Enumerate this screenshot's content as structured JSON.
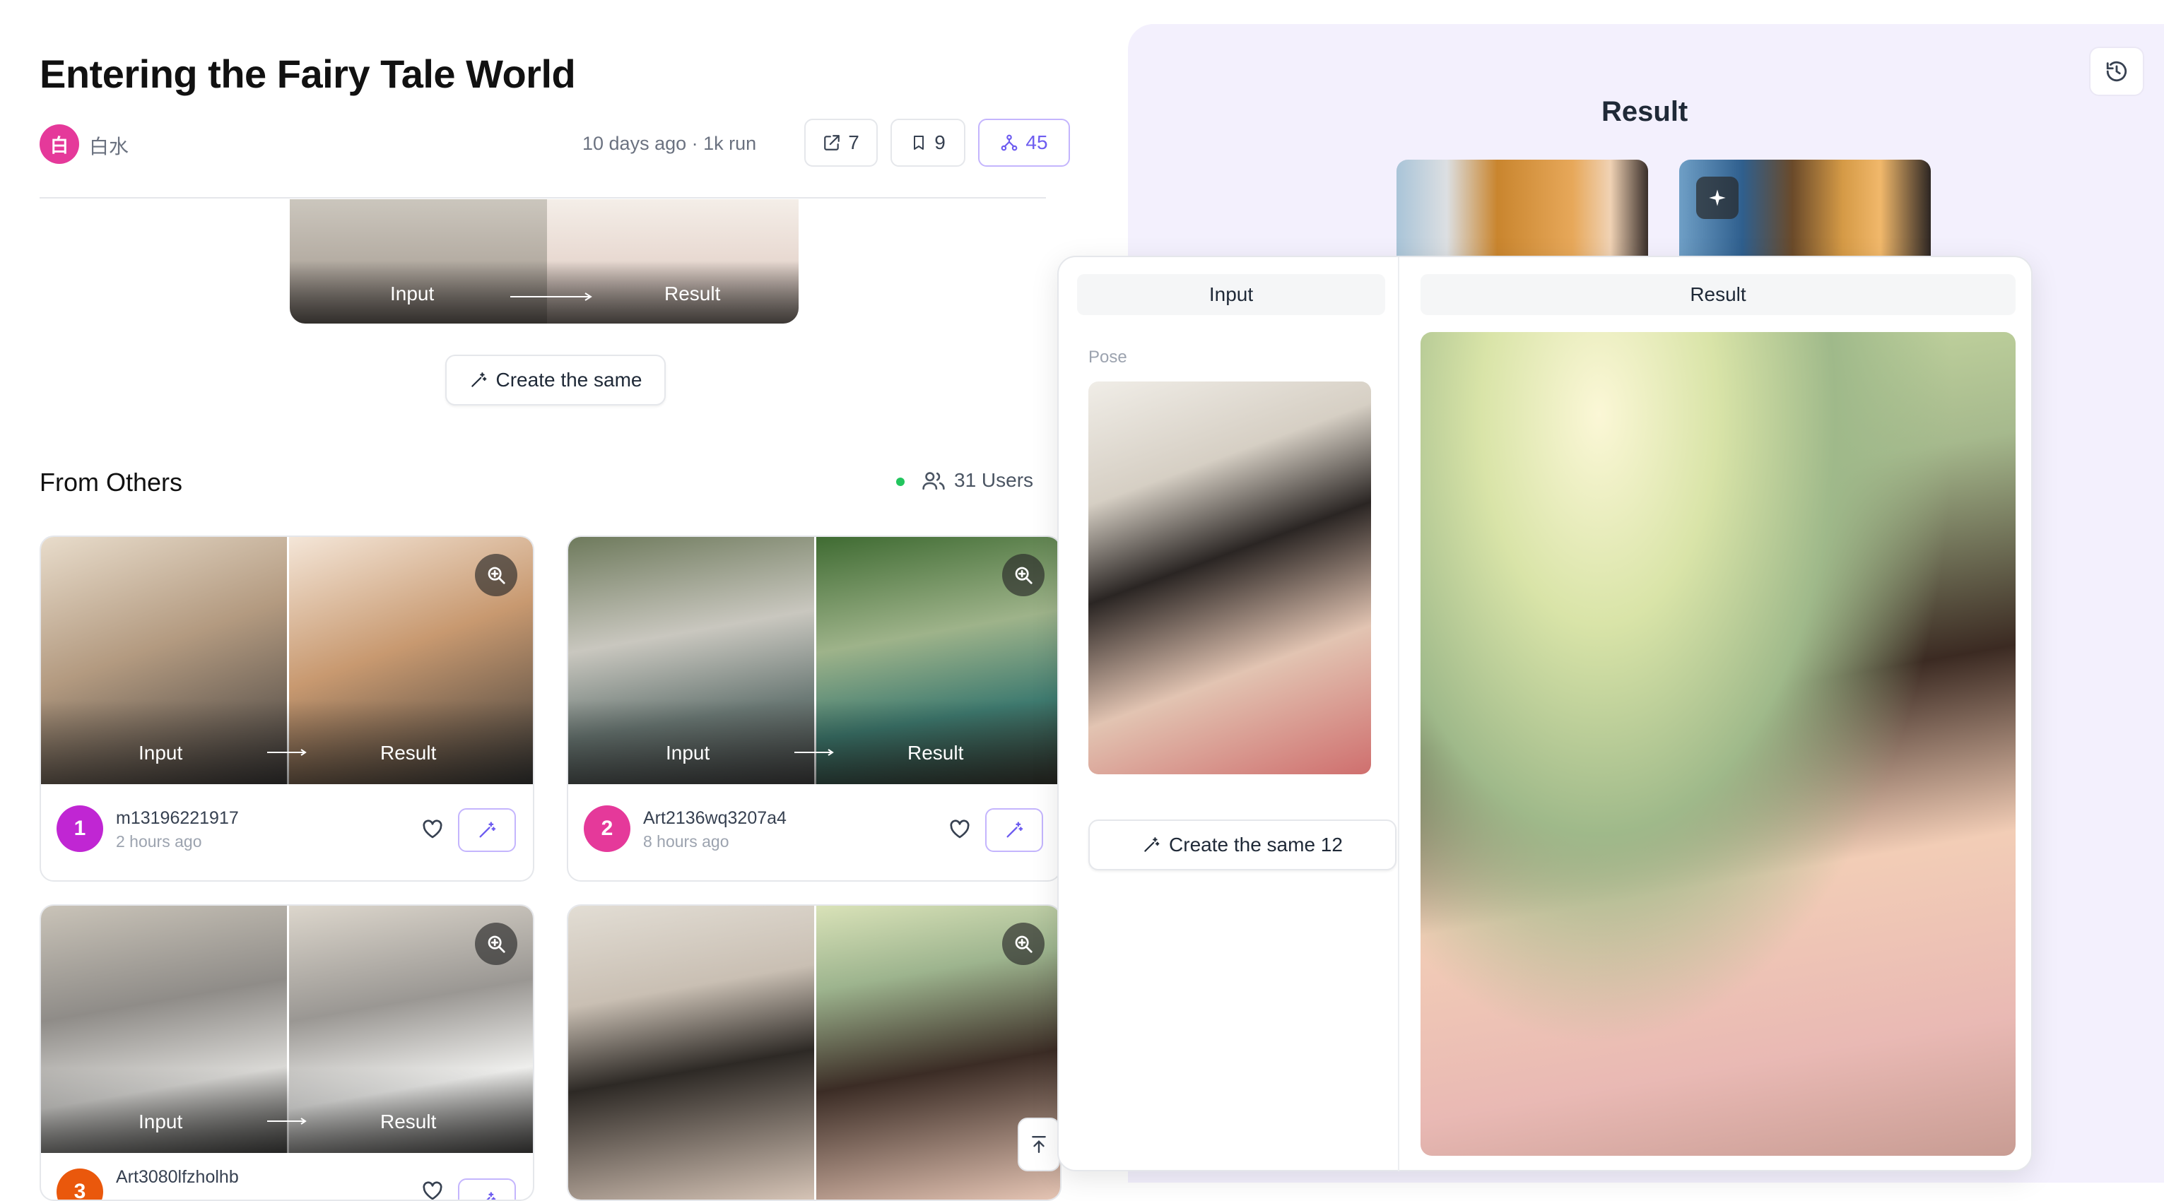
{
  "header": {
    "title": "Entering the Fairy Tale World",
    "author_initial": "白",
    "author_name": "白水",
    "meta": "10 days ago · 1k run",
    "stats": {
      "shares": "7",
      "bookmarks": "9",
      "forks": "45"
    }
  },
  "hero": {
    "input_label": "Input",
    "result_label": "Result"
  },
  "create_same_label": "Create the same",
  "others": {
    "heading": "From Others",
    "users_label": "31 Users",
    "cards": [
      {
        "rank": "1",
        "user": "m13196221917",
        "time": "2 hours ago",
        "input_label": "Input",
        "result_label": "Result"
      },
      {
        "rank": "2",
        "user": "Art2136wq3207a4",
        "time": "8 hours ago",
        "input_label": "Input",
        "result_label": "Result"
      },
      {
        "rank": "3",
        "user": "Art3080lfzholhb",
        "time": "",
        "input_label": "Input",
        "result_label": "Result"
      },
      {
        "rank": "",
        "user": "",
        "time": "",
        "input_label": "",
        "result_label": ""
      }
    ]
  },
  "result_panel": {
    "title": "Result"
  },
  "popover": {
    "input_header": "Input",
    "result_header": "Result",
    "pose_label": "Pose",
    "create_button": "Create the same 12"
  },
  "colors": {
    "accent": "#6d5cf0",
    "rank1": "#c026d3",
    "rank2": "#e5399a",
    "rank3": "#ea580c",
    "panel_bg": "#f3f0fd"
  },
  "icons": [
    "share-icon",
    "bookmark-icon",
    "fork-icon",
    "users-icon",
    "zoom-in-icon",
    "heart-icon",
    "magic-wand-icon",
    "history-icon",
    "sparkle-icon",
    "arrow-up-icon"
  ]
}
